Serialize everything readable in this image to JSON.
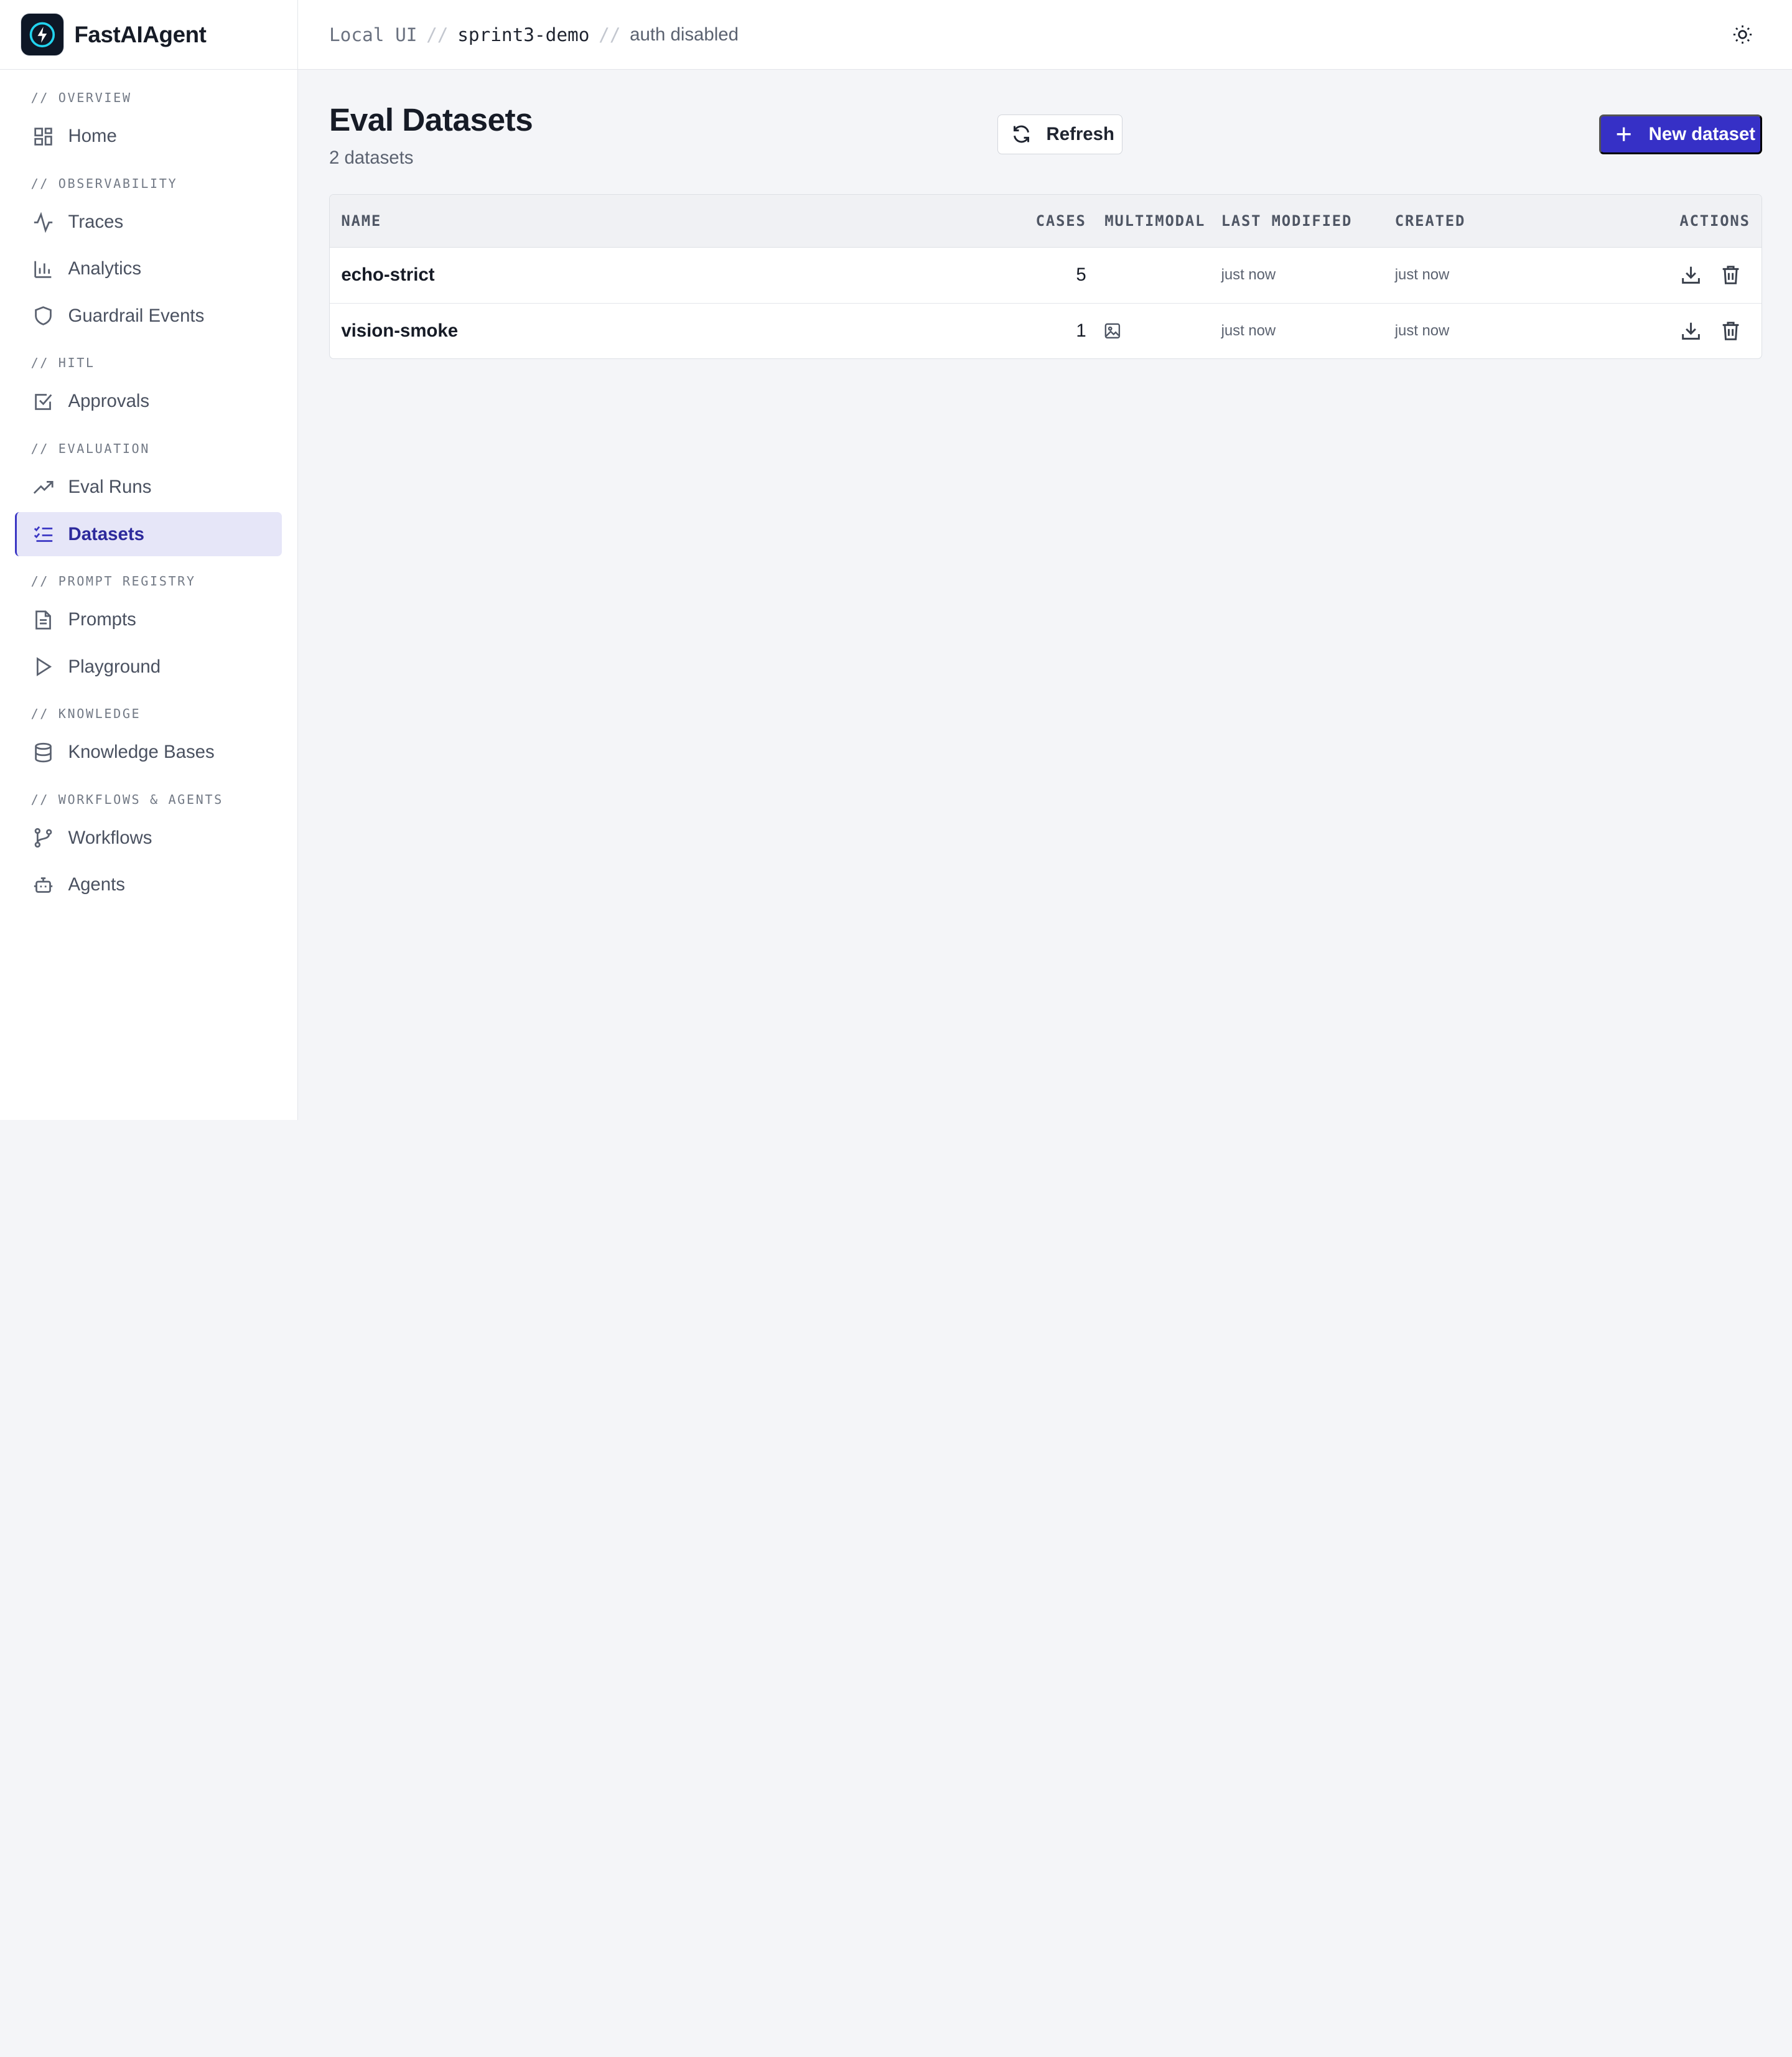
{
  "brand": {
    "name": "FastAIAgent"
  },
  "sidebar": {
    "sections": [
      {
        "label": "// OVERVIEW",
        "items": [
          {
            "label": "Home",
            "icon": "grid-icon"
          }
        ]
      },
      {
        "label": "// OBSERVABILITY",
        "items": [
          {
            "label": "Traces",
            "icon": "activity-icon"
          },
          {
            "label": "Analytics",
            "icon": "bar-chart-icon"
          },
          {
            "label": "Guardrail Events",
            "icon": "shield-icon"
          }
        ]
      },
      {
        "label": "// HITL",
        "items": [
          {
            "label": "Approvals",
            "icon": "check-square-icon"
          }
        ]
      },
      {
        "label": "// EVALUATION",
        "items": [
          {
            "label": "Eval Runs",
            "icon": "trending-up-icon"
          },
          {
            "label": "Datasets",
            "icon": "list-checks-icon",
            "active": true
          }
        ]
      },
      {
        "label": "// PROMPT REGISTRY",
        "items": [
          {
            "label": "Prompts",
            "icon": "file-text-icon"
          },
          {
            "label": "Playground",
            "icon": "play-icon"
          }
        ]
      },
      {
        "label": "// KNOWLEDGE",
        "items": [
          {
            "label": "Knowledge Bases",
            "icon": "database-icon"
          }
        ]
      },
      {
        "label": "// WORKFLOWS & AGENTS",
        "items": [
          {
            "label": "Workflows",
            "icon": "git-branch-icon"
          },
          {
            "label": "Agents",
            "icon": "bot-icon"
          }
        ]
      }
    ]
  },
  "topbar": {
    "crumb_root": "Local UI",
    "separator": "//",
    "crumb_project": "sprint3-demo",
    "crumb_auth": "auth disabled",
    "theme_icon": "sun-icon"
  },
  "page": {
    "title": "Eval Datasets",
    "subtitle": "2 datasets",
    "refresh_label": "Refresh",
    "new_label": "New dataset"
  },
  "table": {
    "columns": {
      "name": "NAME",
      "cases": "CASES",
      "multimodal": "MULTIMODAL",
      "last_modified": "LAST MODIFIED",
      "created": "CREATED",
      "actions": "ACTIONS"
    },
    "rows": [
      {
        "name": "echo-strict",
        "cases": "5",
        "multimodal": false,
        "last_modified": "just now",
        "created": "just now"
      },
      {
        "name": "vision-smoke",
        "cases": "1",
        "multimodal": true,
        "last_modified": "just now",
        "created": "just now"
      }
    ]
  },
  "colors": {
    "accent": "#3630c6",
    "active_bg": "#e6e6f8",
    "background": "#f4f5f8"
  }
}
